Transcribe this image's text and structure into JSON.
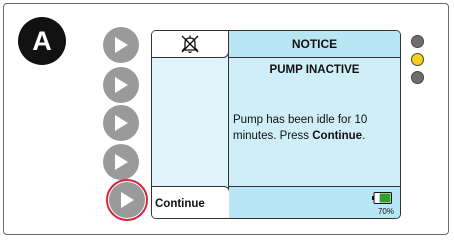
{
  "step_badge": "A",
  "soft_keys": [
    {
      "name": "soft-key-1"
    },
    {
      "name": "soft-key-2"
    },
    {
      "name": "soft-key-3"
    },
    {
      "name": "soft-key-4"
    },
    {
      "name": "soft-key-5",
      "highlighted": true
    }
  ],
  "screen": {
    "icon": "alarm-silenced-icon",
    "title": "NOTICE",
    "subtitle": "PUMP INACTIVE",
    "message_prefix": "Pump has been idle for 10 minutes. Press ",
    "message_bold": "Continue",
    "message_suffix": ".",
    "soft_key_label": "Continue",
    "battery_percent": "70%",
    "battery_level": 0.7
  },
  "indicator_lights": [
    {
      "color": "#6e6e6e"
    },
    {
      "color": "#f3d21a"
    },
    {
      "color": "#6e6e6e"
    }
  ],
  "colors": {
    "screen_bg": "#cfeef7",
    "title_bg": "#b9e6f5",
    "highlight_ring": "#d2263c",
    "battery_fill": "#2ea02e"
  }
}
